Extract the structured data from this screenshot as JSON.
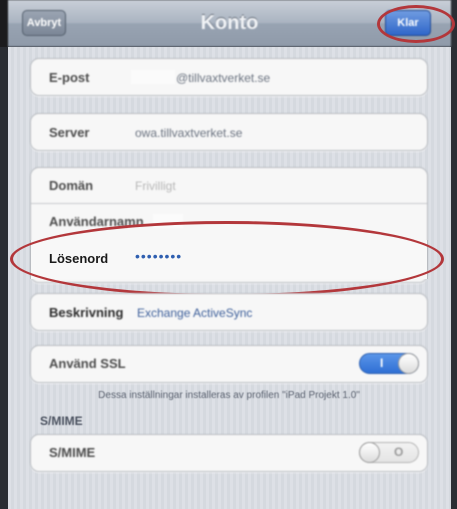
{
  "nav": {
    "cancel_label": "Avbryt",
    "title": "Konto",
    "done_label": "Klar"
  },
  "email_group": {
    "label": "E-post",
    "value": "@tillvaxtverket.se"
  },
  "server_group": {
    "label": "Server",
    "value": "owa.tillvaxtverket.se"
  },
  "auth_group": {
    "domain_label": "Domän",
    "domain_placeholder": "Frivilligt",
    "username_label": "Användarnamn",
    "password_label": "Lösenord",
    "password_value": "••••••••"
  },
  "description_group": {
    "label": "Beskrivning",
    "value": "Exchange ActiveSync"
  },
  "ssl_group": {
    "label": "Använd SSL",
    "toggle_on_mark": "I",
    "enabled": true
  },
  "profile_note": "Dessa inställningar installeras av profilen \"iPad Projekt 1.0\"",
  "smime_section": {
    "header": "S/MIME",
    "row_label": "S/MIME",
    "toggle_off_mark": "O",
    "enabled": false
  },
  "colors": {
    "highlight_circle": "#b3373b",
    "done_button": "#2f66c9",
    "toggle_on": "#2f6fd4"
  },
  "icons": {
    "password_mask": "bullet-dots"
  }
}
